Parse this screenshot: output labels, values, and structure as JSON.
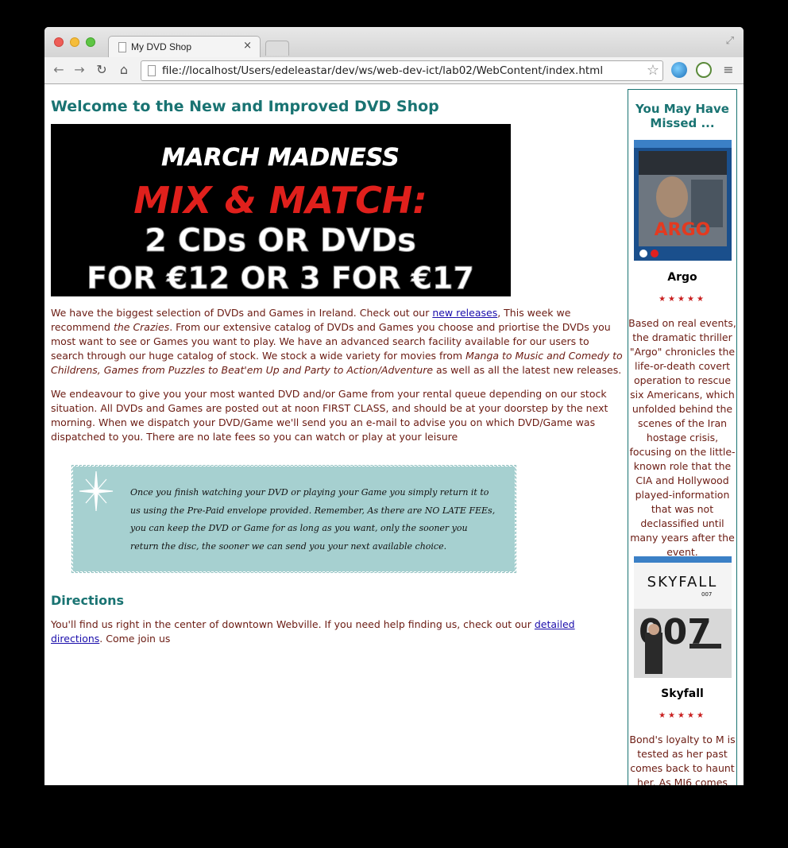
{
  "browser": {
    "tab_title": "My DVD Shop",
    "tab_close": "×",
    "url": "file://localhost/Users/edeleastar/dev/ws/web-dev-ict/lab02/WebContent/index.html",
    "icons": [
      "back-icon",
      "forward-icon",
      "reload-icon",
      "home-icon",
      "bookmark-star-icon",
      "globe-extension-icon",
      "history-clock-icon",
      "menu-icon"
    ]
  },
  "main": {
    "heading": "Welcome to the New and Improved DVD Shop",
    "banner": {
      "line1": "MARCH MADNESS",
      "line2": "MIX & MATCH:",
      "line3": "2 CDs OR DVDs",
      "line4": "FOR €12 OR 3 FOR €17"
    },
    "p1": {
      "t1": "We have the biggest selection of DVDs and Games in Ireland. Check out our ",
      "link": "new releases",
      "t2": ", This week we recommend ",
      "em1": "the Crazies",
      "t3": ". From our extensive catalog of DVDs and Games you choose and priortise the DVDs you most want to see or Games you want to play. We have an advanced search facility available for our users to search through our huge catalog of stock. We stock a wide variety for movies from ",
      "em2": "Manga to Music and Comedy to Childrens, Games from Puzzles to Beat'em Up and Party to Action/Adventure",
      "t4": " as well as all the latest new releases."
    },
    "p2": "We endeavour to give you your most wanted DVD and/or Game from your rental queue depending on our stock situation. All DVDs and Games are posted out at noon FIRST CLASS, and should be at your doorstep by the next morning. When we dispatch your DVD/Game we'll send you an e-mail to advise you on which DVD/Game was dispatched to you. There are no late fees so you can watch or play at your leisure",
    "quote": "Once you finish watching your DVD or playing your Game you simply return it to us using the Pre-Paid envelope provided. Remember, As there are NO LATE FEEs, you can keep the DVD or Game for as long as you want, only the sooner you return the disc, the sooner we can send you your next available choice.",
    "directions_heading": "Directions",
    "p3": {
      "t1": "You'll find us right in the center of downtown Webville. If you need help finding us, check out our ",
      "link": "detailed directions",
      "t2": ". Come join us"
    }
  },
  "sidebar": {
    "title": "You May Have Missed ...",
    "movies": [
      {
        "title": "Argo",
        "rating": 4.5,
        "stars": "★★★★★",
        "cover_text": "ARGO",
        "description": "Based on real events, the dramatic thriller \"Argo\" chronicles the life-or-death covert operation to rescue six Americans, which unfolded behind the scenes of the Iran hostage crisis, focusing on the little-known role that the CIA and Hollywood played-information that was not declassified until many years after the event."
      },
      {
        "title": "Skyfall",
        "rating": 4.5,
        "stars": "★★★★★",
        "cover_text": "SKYFALL",
        "cover_subtext": "007",
        "description": "Bond's loyalty to M is tested as her past comes back to haunt her. As MI6 comes"
      }
    ]
  },
  "colors": {
    "heading": "#197372",
    "body_text": "#6b1b12",
    "quote_bg": "#a6d0d0",
    "banner_red": "#e0201c"
  }
}
